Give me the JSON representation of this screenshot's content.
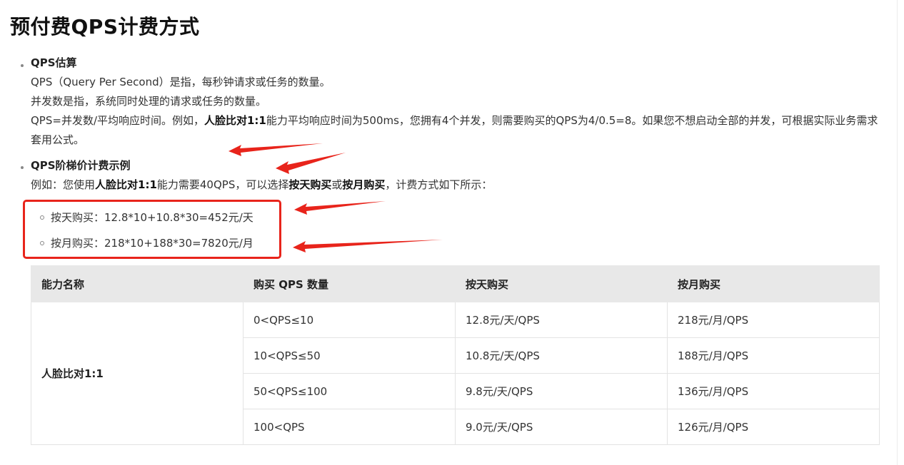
{
  "page_title": "预付费QPS计费方式",
  "section1": {
    "heading": "QPS估算",
    "line1": "QPS（Query Per Second）是指，每秒钟请求或任务的数量。",
    "line2": "并发数是指，系统同时处理的请求或任务的数量。",
    "line3_pre": "QPS=并发数/平均响应时间。例如，",
    "line3_bold": "人脸比对1:1",
    "line3_post": "能力平均响应时间为500ms，您拥有4个并发，则需要购买的QPS为4/0.5=8。如果您不想启动全部的并发，可根据实际业务需求套用公式。"
  },
  "section2": {
    "heading": "QPS阶梯价计费示例",
    "intro_pre": "例如：您使用",
    "intro_bold1": "人脸比对1:1",
    "intro_mid": "能力需要40QPS，可以选择",
    "intro_bold2": "按天购买",
    "intro_or": "或",
    "intro_bold3": "按月购买",
    "intro_post": "，计费方式如下所示：",
    "examples": [
      "按天购买：12.8*10+10.8*30=452元/天",
      "按月购买：218*10+188*30=7820元/月"
    ]
  },
  "table": {
    "headers": [
      "能力名称",
      "购买 QPS 数量",
      "按天购买",
      "按月购买"
    ],
    "capability": "人脸比对1:1",
    "rows": [
      {
        "qps": "0<QPS≤10",
        "daily": "12.8元/天/QPS",
        "monthly": "218元/月/QPS"
      },
      {
        "qps": "10<QPS≤50",
        "daily": "10.8元/天/QPS",
        "monthly": "188元/月/QPS"
      },
      {
        "qps": "50<QPS≤100",
        "daily": "9.8元/天/QPS",
        "monthly": "136元/月/QPS"
      },
      {
        "qps": "100<QPS",
        "daily": "9.0元/天/QPS",
        "monthly": "126元/月/QPS"
      }
    ]
  },
  "colors": {
    "annotation_red": "#e8241b",
    "table_header_bg": "#e8e8e8",
    "text": "#333333"
  },
  "icons": [
    "bullet-dot-icon",
    "hollow-circle-bullet-icon",
    "red-arrow-annotation-icon"
  ]
}
